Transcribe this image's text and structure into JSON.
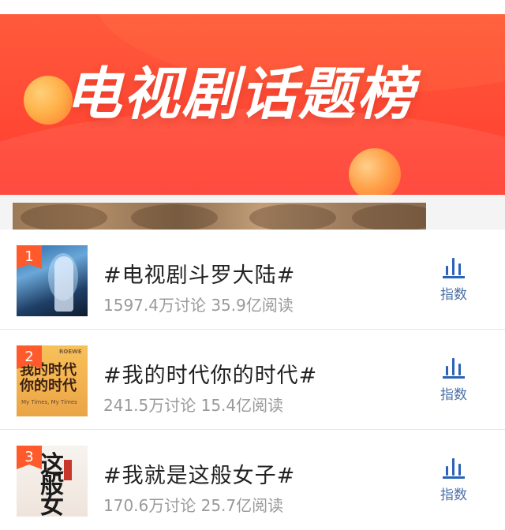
{
  "banner": {
    "title": "电视剧话题榜"
  },
  "topics": [
    {
      "rank": "1",
      "title": "#电视剧斗罗大陆#",
      "stats": "1597.4万讨论 35.9亿阅读",
      "index_label": "指数"
    },
    {
      "rank": "2",
      "title": "#我的时代你的时代#",
      "stats": "241.5万讨论 15.4亿阅读",
      "index_label": "指数",
      "thumb_text": "我的时代你的时代",
      "thumb_brand": "ROEWE",
      "thumb_sub": "My Times, My Times"
    },
    {
      "rank": "3",
      "title": "#我就是这般女子#",
      "stats": "170.6万讨论 25.7亿阅读",
      "index_label": "指数",
      "thumb_text": "这般女"
    }
  ],
  "colors": {
    "banner_red": "#ff4a35",
    "rank_badge": "#ff5a2c",
    "index_blue": "#2a63b8",
    "stats_gray": "#9a9a9a"
  },
  "icons": {
    "index": "bar-chart-icon"
  }
}
